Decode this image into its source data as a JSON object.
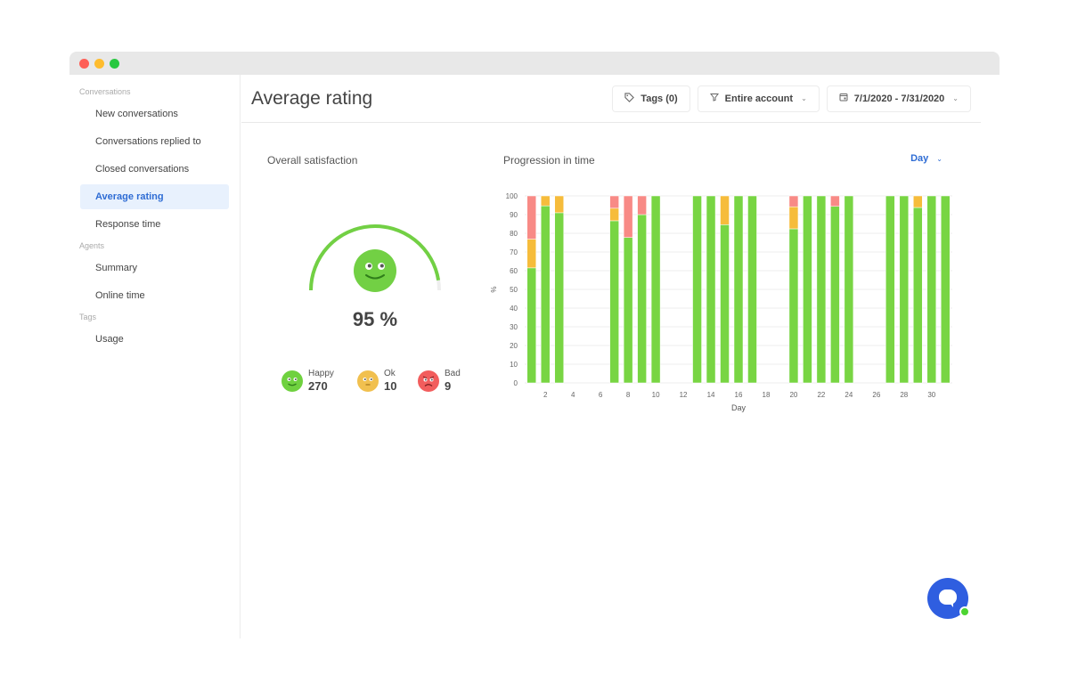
{
  "window": {
    "controls": [
      "close",
      "minimize",
      "maximize"
    ]
  },
  "sidebar": {
    "sections": [
      {
        "title": "Conversations",
        "items": [
          {
            "label": "New conversations",
            "active": false
          },
          {
            "label": "Conversations replied to",
            "active": false
          },
          {
            "label": "Closed conversations",
            "active": false
          },
          {
            "label": "Average rating",
            "active": true
          },
          {
            "label": "Response time",
            "active": false
          }
        ]
      },
      {
        "title": "Agents",
        "items": [
          {
            "label": "Summary",
            "active": false
          },
          {
            "label": "Online time",
            "active": false
          }
        ]
      },
      {
        "title": "Tags",
        "items": [
          {
            "label": "Usage",
            "active": false
          }
        ]
      }
    ]
  },
  "header": {
    "title": "Average rating",
    "tags_button": {
      "icon": "tag-icon",
      "label": "Tags (0)"
    },
    "scope_button": {
      "icon": "filter-icon",
      "label": "Entire account"
    },
    "date_button": {
      "icon": "calendar-icon",
      "label": "7/1/2020 - 7/31/2020"
    }
  },
  "satisfaction": {
    "title": "Overall satisfaction",
    "percent": 95,
    "percent_label": "95 %",
    "legend": [
      {
        "label": "Happy",
        "value": "270",
        "color": "#6fd13f"
      },
      {
        "label": "Ok",
        "value": "10",
        "color": "#f1c04f"
      },
      {
        "label": "Bad",
        "value": "9",
        "color": "#f25d5d"
      }
    ]
  },
  "progression": {
    "title": "Progression in time",
    "granularity": "Day"
  },
  "colors": {
    "happy": "#78d543",
    "ok": "#f6bc3b",
    "bad": "#f88a86",
    "accent": "#2e6cd4"
  },
  "chart_data": {
    "type": "bar",
    "stacked": true,
    "title": "Progression in time",
    "xlabel": "Day",
    "ylabel": "%",
    "ylim": [
      0,
      100
    ],
    "yticks": [
      0,
      10,
      20,
      30,
      40,
      50,
      60,
      70,
      80,
      90,
      100
    ],
    "xticks": [
      2,
      4,
      6,
      8,
      10,
      12,
      14,
      16,
      18,
      20,
      22,
      24,
      26,
      28,
      30
    ],
    "grid": true,
    "x": [
      1,
      2,
      3,
      4,
      5,
      6,
      7,
      8,
      9,
      10,
      11,
      12,
      13,
      14,
      15,
      16,
      17,
      18,
      19,
      20,
      21,
      22,
      23,
      24,
      25,
      26,
      27,
      28,
      29,
      30,
      31
    ],
    "series": [
      {
        "name": "Happy",
        "values": [
          61.5,
          94.7,
          91,
          0,
          0,
          0,
          86.7,
          77.8,
          90,
          100,
          0,
          0,
          100,
          100,
          84.6,
          100,
          100,
          0,
          0,
          82.4,
          100,
          100,
          94.4,
          100,
          0,
          0,
          100,
          100,
          93.8,
          100,
          100
        ]
      },
      {
        "name": "Ok",
        "values": [
          15.4,
          5.3,
          9,
          0,
          0,
          0,
          6.7,
          0,
          0,
          0,
          0,
          0,
          0,
          0,
          15.4,
          0,
          0,
          0,
          0,
          11.8,
          0,
          0,
          0,
          0,
          0,
          0,
          0,
          0,
          6.2,
          0,
          0
        ]
      },
      {
        "name": "Bad",
        "values": [
          23.1,
          0,
          0,
          0,
          0,
          0,
          6.6,
          22.2,
          10,
          0,
          0,
          0,
          0,
          0,
          0,
          0,
          0,
          0,
          0,
          5.8,
          0,
          0,
          5.6,
          0,
          0,
          0,
          0,
          0,
          0,
          0,
          0
        ]
      }
    ]
  }
}
